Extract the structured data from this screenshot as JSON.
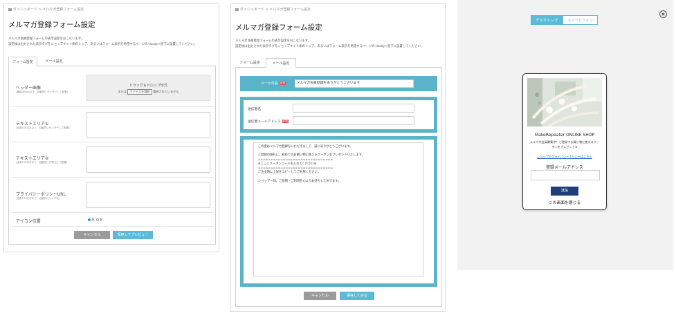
{
  "left_panel": {
    "breadcrumb": "ダッシュボード > メルマガ登録フォーム設定",
    "title": "メルマガ登録フォーム設定",
    "desc_line1": "メルマガ会員登録フォームの表示設定をおこないます。",
    "desc_line2": "設定後は出力された表示タグをショップサイト側のトップ、あるいはフォーム表示を希望するページの<body>直下に設置してください。",
    "tabs": [
      "フォーム設定",
      "メール設定"
    ],
    "header_image": {
      "label": "ヘッダー画像",
      "sub": "(横幅300px以下、自動的にセンターにて配置)",
      "drop_title": "ドラッグ＆ドロップ形式",
      "or_text": "または",
      "choose_button": "ファイルを選択",
      "no_file": "選択されていません"
    },
    "text_area_1": {
      "label": "テキストエリア①",
      "sub": "(全角100文字まで、自動的にセンターにて配置)"
    },
    "text_area_2": {
      "label": "テキストエリア②",
      "sub": "(全角100文字まで、自動的に左寄せにて配置)"
    },
    "privacy_url": {
      "label": "プライバシーポリシーURL",
      "sub": "(全角100文字まで、自動的にリンク化)"
    },
    "icon_position": {
      "label": "アイコン位置",
      "options": [
        "左",
        "右"
      ],
      "selected": "左"
    },
    "cancel_button": "キャンセル",
    "preview_button": "保存してプレビュー"
  },
  "middle_panel": {
    "breadcrumb": "ダッシュボード > メルマガ登録フォーム設定",
    "title": "メルマガ登録フォーム設定",
    "desc_line1": "メルマガ会員登録フォームの表示設定をおこないます。",
    "desc_line2": "設定後は出力された表示タグをショップサイト側のトップ、あるいはフォーム表示を希望するページの<body>直下に設置してください。",
    "tabs": [
      "フォーム設定",
      "メール設定"
    ],
    "subject": {
      "label": "メール件名",
      "required": "必須",
      "value": "メルマガ会員登録をありがとうございます"
    },
    "sender_name": {
      "label": "送信者名",
      "value": ""
    },
    "sender_email": {
      "label": "送信者メールアドレス",
      "required": "必須",
      "value": ""
    },
    "body_text": "この度はメルマガ登録をいただきまして、誠にありがとうございます。\n\nご登録の御礼に、初めてのお買い物に使えるクーポンをプレゼントいたします。\n==============================\n※ここにクーポンコードを入れてください※\n==============================\nご注文時に上記をコピーしてご利用ください。\n\nショップ一同、ご訪問・ご利用を心よりお待ちしております。",
    "cancel_button": "キャンセル",
    "save_back_button": "保存して戻る"
  },
  "preview": {
    "device_tabs": [
      "デスクトップ",
      "スマートフォン"
    ],
    "selected_device": "デスクトップ",
    "shop_name": "MakeRepeater ONLINE SHOP",
    "message_line1": "メルマガ会員募集中！ご登録でお買い物に使えるクー",
    "message_line2": "ポンをプレゼント★",
    "privacy_link": "ショップのプライバシーポリシーはこちら",
    "email_label": "登録メールアドレス",
    "submit_button": "送信",
    "close_text": "この画面を閉じる"
  },
  "colors": {
    "accent": "#5bbad5",
    "band": "#5bb3ca",
    "submit": "#1f3f7a",
    "required": "#d9534f"
  }
}
